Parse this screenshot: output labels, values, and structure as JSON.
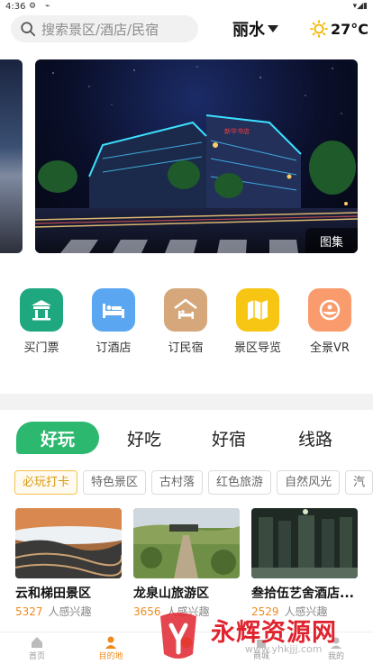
{
  "status_bar": {
    "time": "4:36"
  },
  "header": {
    "search_placeholder": "搜索景区/酒店/民宿",
    "city": "丽水",
    "temperature": "27°C"
  },
  "banner": {
    "gallery_label": "图集",
    "sign_text": "新华书店"
  },
  "quick_menu": [
    {
      "label": "买门票",
      "icon": "ticket-gate-icon",
      "color": "#1fa77f"
    },
    {
      "label": "订酒店",
      "icon": "hotel-bed-icon",
      "color": "#5aa6f0"
    },
    {
      "label": "订民宿",
      "icon": "homestay-icon",
      "color": "#d5a77a"
    },
    {
      "label": "景区导览",
      "icon": "map-guide-icon",
      "color": "#f7c514"
    },
    {
      "label": "全景VR",
      "icon": "vr-panorama-icon",
      "color": "#f99b6d"
    }
  ],
  "tabs": [
    "好玩",
    "好吃",
    "好宿",
    "线路"
  ],
  "chips": [
    "必玩打卡",
    "特色景区",
    "古村落",
    "红色旅游",
    "自然风光",
    "汽"
  ],
  "cards": [
    {
      "title": "云和梯田景区",
      "count": "5327",
      "suffix": "人感兴趣"
    },
    {
      "title": "龙泉山旅游区",
      "count": "3656",
      "suffix": "人感兴趣"
    },
    {
      "title": "叁拾伍艺舍酒店...",
      "count": "2529",
      "suffix": "人感兴趣"
    }
  ],
  "bottom_nav": [
    "首页",
    "目的地",
    "",
    "商城",
    "我的"
  ],
  "watermark": {
    "title": "永辉资源网",
    "url": "www.yhkjjj.com"
  }
}
